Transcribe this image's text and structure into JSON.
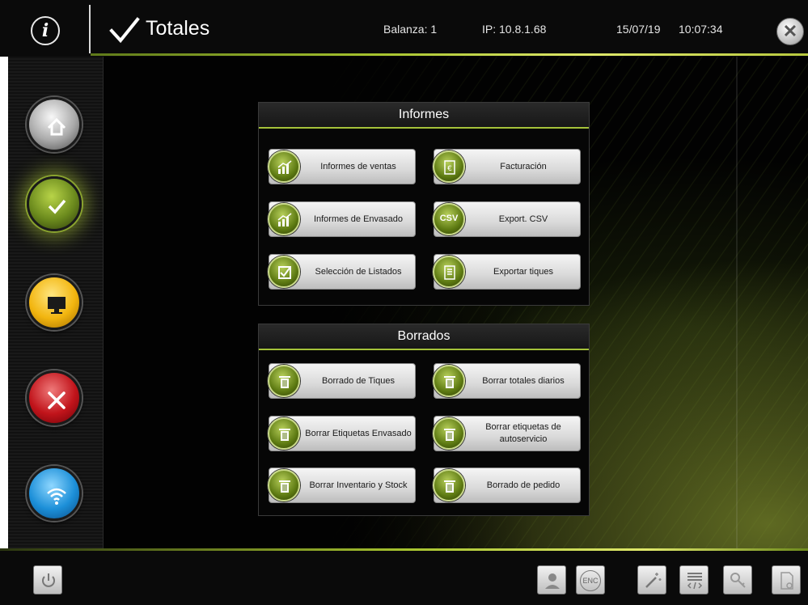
{
  "header": {
    "title": "Totales",
    "balanza": "Balanza: 1",
    "ip": "IP: 10.8.1.68",
    "date": "15/07/19",
    "time": "10:07:34"
  },
  "sidebar": {
    "items": [
      {
        "name": "home",
        "icon": "home-icon",
        "color": "#a9a9a9"
      },
      {
        "name": "totals",
        "icon": "check-icon",
        "color": "#6b8a1d",
        "active": true
      },
      {
        "name": "display",
        "icon": "monitor-icon",
        "color": "#f2b50f"
      },
      {
        "name": "tools",
        "icon": "tools-icon",
        "color": "#c1141b"
      },
      {
        "name": "wifi",
        "icon": "wifi-icon",
        "color": "#1c8fd8"
      }
    ]
  },
  "informes": {
    "title": "Informes",
    "buttons": [
      {
        "label": "Informes de ventas",
        "icon": "chart-icon"
      },
      {
        "label": "Facturación",
        "icon": "invoice-icon"
      },
      {
        "label": "Informes de Envasado",
        "icon": "chart-icon"
      },
      {
        "label": "Export. CSV",
        "icon": "csv-icon",
        "icon_text": "CSV"
      },
      {
        "label": "Selección de Listados",
        "icon": "checkbox-icon"
      },
      {
        "label": "Exportar tiques",
        "icon": "ticket-icon"
      }
    ]
  },
  "borrados": {
    "title": "Borrados",
    "buttons": [
      {
        "label": "Borrado de Tiques",
        "icon": "trash-icon"
      },
      {
        "label": "Borrar totales diarios",
        "icon": "trash-icon"
      },
      {
        "label": "Borrar Etiquetas Envasado",
        "icon": "trash-icon"
      },
      {
        "label": "Borrar etiquetas de autoservicio",
        "icon": "trash-icon"
      },
      {
        "label": "Borrar Inventario y Stock",
        "icon": "trash-icon"
      },
      {
        "label": "Borrado de pedido",
        "icon": "trash-icon"
      }
    ]
  },
  "bottom": {
    "enc_label": "ENC",
    "tools": [
      "support-icon",
      "enc-icon",
      "wand-icon",
      "code-list-icon",
      "key-icon",
      "document-settings-icon"
    ]
  },
  "colors": {
    "accent": "#a5c23a",
    "background": "#020202"
  }
}
